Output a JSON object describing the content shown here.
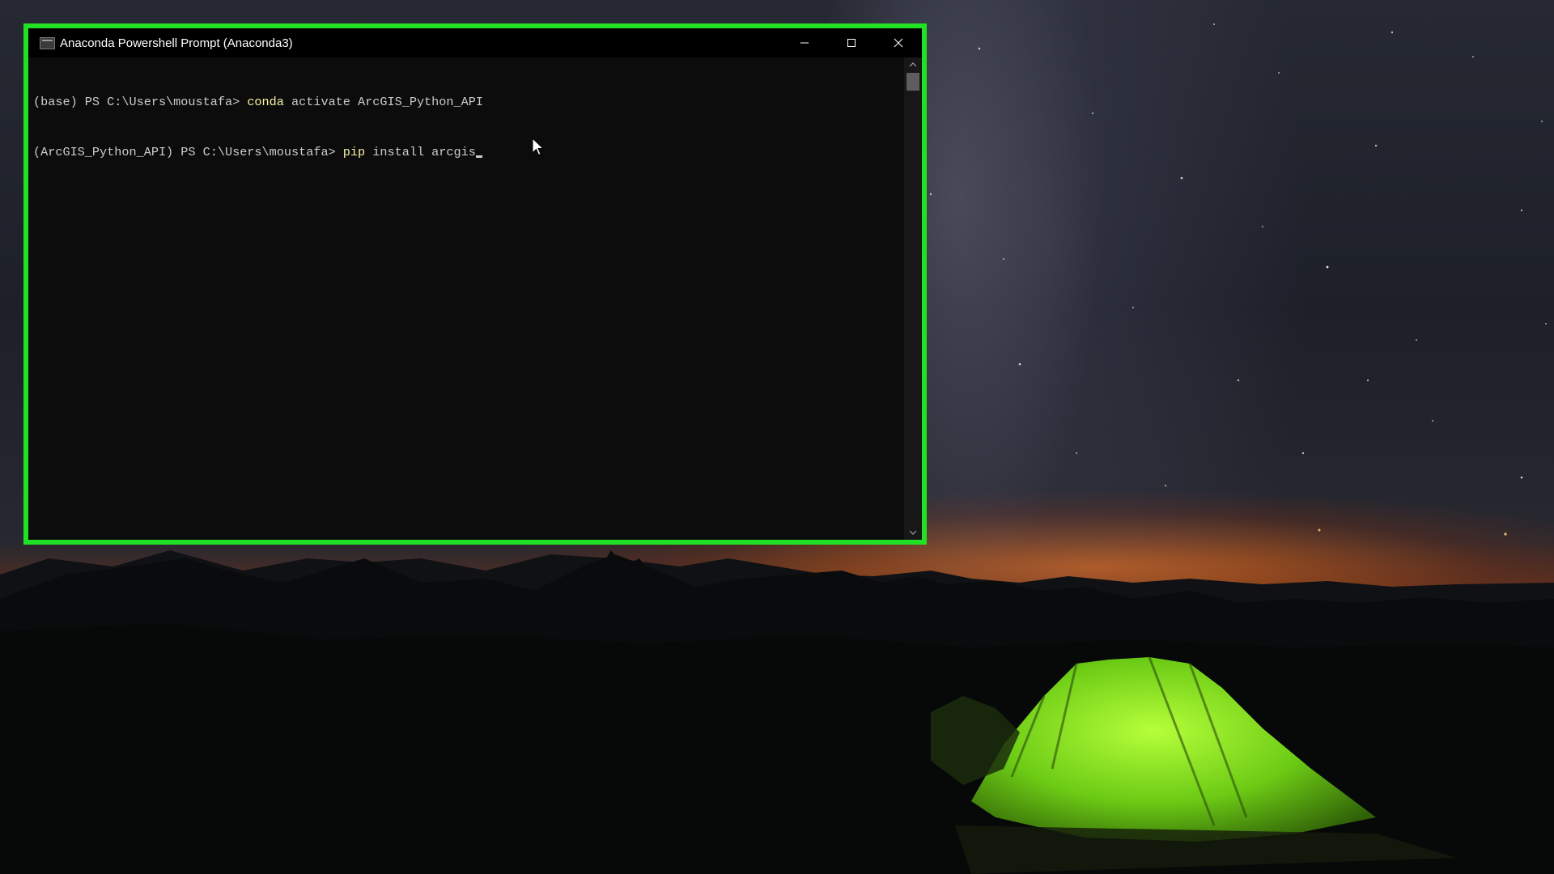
{
  "window": {
    "title": "Anaconda Powershell Prompt (Anaconda3)",
    "controls": {
      "minimize_icon": "minimize-icon",
      "maximize_icon": "maximize-icon",
      "close_icon": "close-icon"
    },
    "frame_highlight_color": "#22e023"
  },
  "console": {
    "lines": [
      {
        "prompt": "(base) PS C:\\Users\\moustafa> ",
        "command": "conda",
        "args": " activate ArcGIS_Python_API"
      },
      {
        "prompt": "(ArcGIS_Python_API) PS C:\\Users\\moustafa> ",
        "command": "pip",
        "args": " install arcgis"
      }
    ],
    "text_color": "#cccccc",
    "command_color": "#f9f1a5",
    "background": "#0c0c0c"
  },
  "desktop": {
    "wallpaper": "night sky with milky way over mountains and a glowing green tent"
  }
}
